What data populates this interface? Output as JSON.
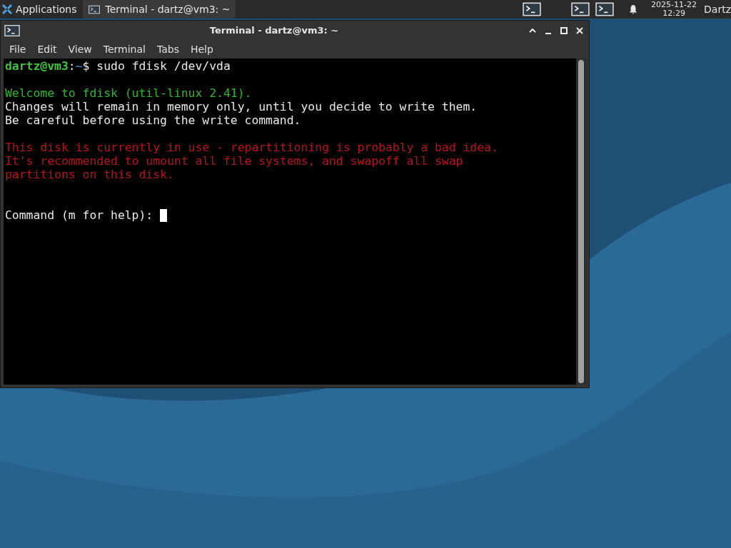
{
  "panel": {
    "menu_label": "Applications",
    "tasks": [
      {
        "title": "Terminal - dartz@vm3: ~",
        "selected": true
      }
    ],
    "clock": {
      "date": "2025-11-22",
      "time": "12:29"
    },
    "user": "Dartz"
  },
  "window": {
    "title": "Terminal - dartz@vm3: ~",
    "menu": [
      "File",
      "Edit",
      "View",
      "Terminal",
      "Tabs",
      "Help"
    ]
  },
  "terminal": {
    "lines": [
      {
        "kind": "prompt",
        "user": "dartz@vm3",
        "sep": ":",
        "path": "~",
        "command": "$ sudo fdisk /dev/vda"
      },
      {
        "kind": "blank"
      },
      {
        "kind": "info",
        "text": "Welcome to fdisk (util-linux 2.41)."
      },
      {
        "kind": "output",
        "text": "Changes will remain in memory only, until you decide to write them."
      },
      {
        "kind": "output",
        "text": "Be careful before using the write command."
      },
      {
        "kind": "blank"
      },
      {
        "kind": "error",
        "text": "This disk is currently in use - repartitioning is probably a bad idea."
      },
      {
        "kind": "error",
        "text": "It's recommended to umount all file systems, and swapoff all swap"
      },
      {
        "kind": "error",
        "text": "partitions on this disk."
      },
      {
        "kind": "blank"
      },
      {
        "kind": "blank"
      },
      {
        "kind": "input",
        "text": "Command (m for help): ",
        "cursor": true
      }
    ]
  }
}
